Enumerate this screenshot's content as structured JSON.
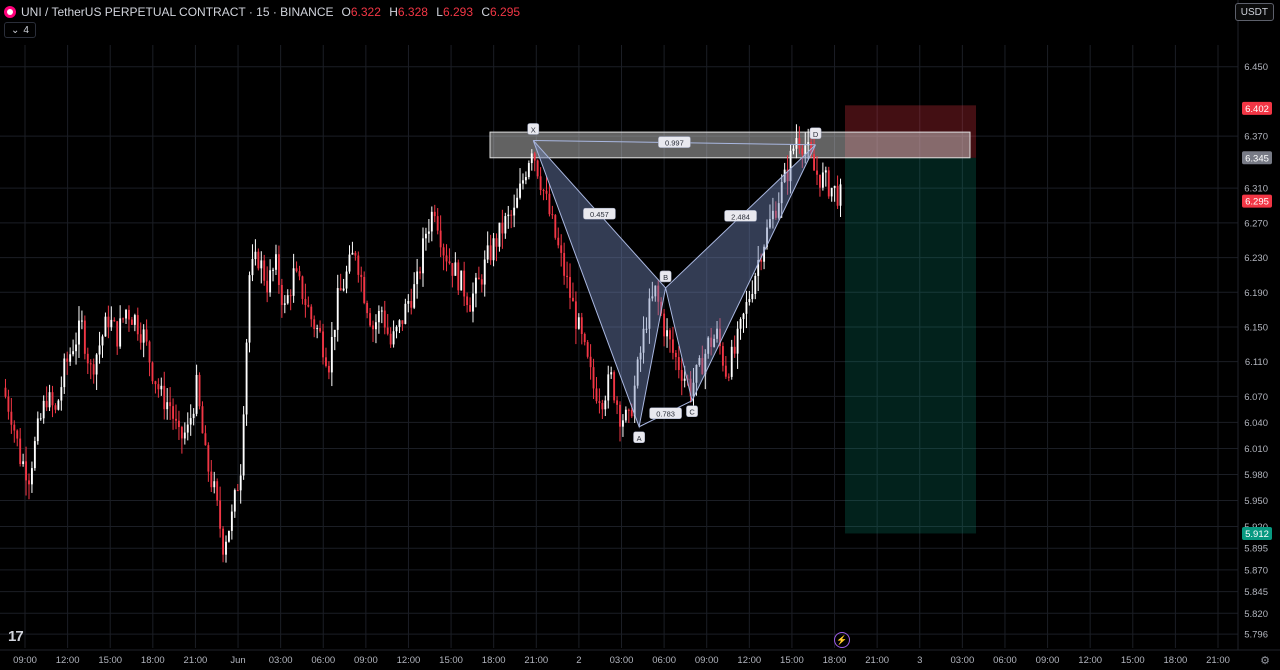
{
  "header": {
    "symbol": "UNI / TetherUS PERPETUAL CONTRACT · 15 · BINANCE",
    "o_label": "O",
    "o_value": "6.322",
    "h_label": "H",
    "h_value": "6.328",
    "l_label": "L",
    "l_value": "6.293",
    "c_label": "C",
    "c_value": "6.295",
    "indicator_count": "4",
    "indicator_icon": "chevron-down-icon",
    "unit": "USDT"
  },
  "branding": {
    "logo_text": "17",
    "logo_icon": "tradingview-logo"
  },
  "colors": {
    "up": "#ffffff",
    "down": "#f23645",
    "pattern": "#7286b8",
    "box": "#d9d9d9",
    "stop_zone": "#f23645",
    "target_zone": "#089981",
    "grid": "#1b1e25"
  },
  "chart_data": {
    "type": "candlestick",
    "ylim": [
      5.78,
      6.475
    ],
    "y_ticks": [
      "6.450",
      "6.370",
      "6.310",
      "6.270",
      "6.230",
      "6.190",
      "6.150",
      "6.110",
      "6.070",
      "6.040",
      "6.010",
      "5.980",
      "5.950",
      "5.920",
      "5.895",
      "5.870",
      "5.845",
      "5.820",
      "5.796"
    ],
    "x_ticks": [
      "09:00",
      "12:00",
      "15:00",
      "18:00",
      "21:00",
      "Jun",
      "03:00",
      "06:00",
      "09:00",
      "12:00",
      "15:00",
      "18:00",
      "21:00",
      "2",
      "03:00",
      "06:00",
      "09:00",
      "12:00",
      "15:00",
      "18:00",
      "21:00",
      "3",
      "03:00",
      "06:00",
      "09:00",
      "12:00",
      "15:00",
      "18:00",
      "21:00"
    ],
    "price_labels": [
      {
        "value": "6.402",
        "kind": "stop"
      },
      {
        "value": "6.345",
        "kind": "entry"
      },
      {
        "value": "6.295",
        "kind": "last"
      },
      {
        "value": "5.912",
        "kind": "target"
      }
    ],
    "price_path": [
      6.08,
      6.05,
      6.0,
      5.98,
      6.03,
      6.07,
      6.05,
      6.1,
      6.13,
      6.15,
      6.1,
      6.13,
      6.16,
      6.14,
      6.17,
      6.16,
      6.14,
      6.1,
      6.07,
      6.06,
      6.02,
      6.03,
      6.08,
      6.0,
      5.96,
      5.9,
      5.93,
      5.99,
      6.21,
      6.23,
      6.2,
      6.22,
      6.17,
      6.21,
      6.19,
      6.16,
      6.14,
      6.11,
      6.18,
      6.21,
      6.24,
      6.19,
      6.15,
      6.17,
      6.13,
      6.15,
      6.18,
      6.2,
      6.26,
      6.29,
      6.24,
      6.22,
      6.2,
      6.18,
      6.2,
      6.23,
      6.25,
      6.27,
      6.28,
      6.32,
      6.36,
      6.32,
      6.28,
      6.24,
      6.2,
      6.16,
      6.12,
      6.08,
      6.07,
      6.09,
      6.05,
      6.04,
      6.1,
      6.16,
      6.19,
      6.15,
      6.12,
      6.1,
      6.08,
      6.1,
      6.13,
      6.14,
      6.1,
      6.12,
      6.16,
      6.2,
      6.24,
      6.27,
      6.3,
      6.33,
      6.37,
      6.36,
      6.33,
      6.32,
      6.31,
      6.3
    ],
    "harmonic_pattern": {
      "points": [
        {
          "label": "X",
          "x_index": 60,
          "price": 6.365
        },
        {
          "label": "A",
          "x_index": 72,
          "price": 6.035
        },
        {
          "label": "B",
          "x_index": 75,
          "price": 6.195
        },
        {
          "label": "C",
          "x_index": 78,
          "price": 6.065
        },
        {
          "label": "D",
          "x_index": 92,
          "price": 6.36
        }
      ],
      "ratios": [
        "0.457",
        "0.783",
        "2.484",
        "0.997"
      ]
    },
    "resistance_zone": {
      "top": 6.37,
      "bottom": 6.345
    },
    "position": {
      "entry": 6.345,
      "stop": 6.402,
      "target": 5.912
    }
  }
}
